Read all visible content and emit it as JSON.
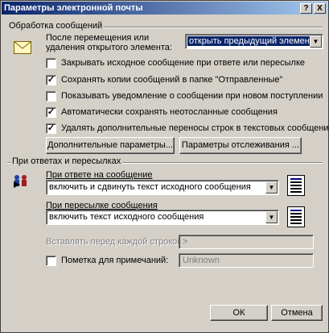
{
  "window": {
    "title": "Параметры электронной почты",
    "help_glyph": "?",
    "close_glyph": "X"
  },
  "message_handling": {
    "group_title": "Обработка сообщений",
    "after_move_label": "После перемещения или удаления открытого элемента:",
    "after_move_value": "открыть предыдущий элемент",
    "checkboxes": [
      {
        "label": "Закрывать исходное сообщение при ответе или пересылке",
        "checked": false
      },
      {
        "label": "Сохранять копии сообщений в папке \"Отправленные\"",
        "checked": true
      },
      {
        "label": "Показывать уведомление о сообщении при новом поступлении",
        "checked": false
      },
      {
        "label": "Автоматически сохранять неотосланные сообщения",
        "checked": true
      },
      {
        "label": "Удалять дополнительные переносы строк в текстовых сообщениях",
        "checked": true
      }
    ],
    "advanced_button": "Дополнительные параметры...",
    "tracking_button": "Параметры отслеживания ..."
  },
  "reply_forward": {
    "group_title": "При ответах и пересылках",
    "reply_label": "При ответе на сообщение",
    "reply_value": "включить и сдвинуть текст исходного сообщения",
    "forward_label": "При пересылке сообщения",
    "forward_value": "включить текст исходного сообщения",
    "prefix_label": "Вставлять перед каждой строкой:",
    "prefix_value": ">",
    "comments_label": "Пометка для примечаний:",
    "comments_value": "Unknown",
    "comments_checked": false
  },
  "footer": {
    "ok": "ОК",
    "cancel": "Отмена"
  },
  "icons": {
    "envelope": "envelope-icon",
    "reply": "reply-forward-icon"
  }
}
